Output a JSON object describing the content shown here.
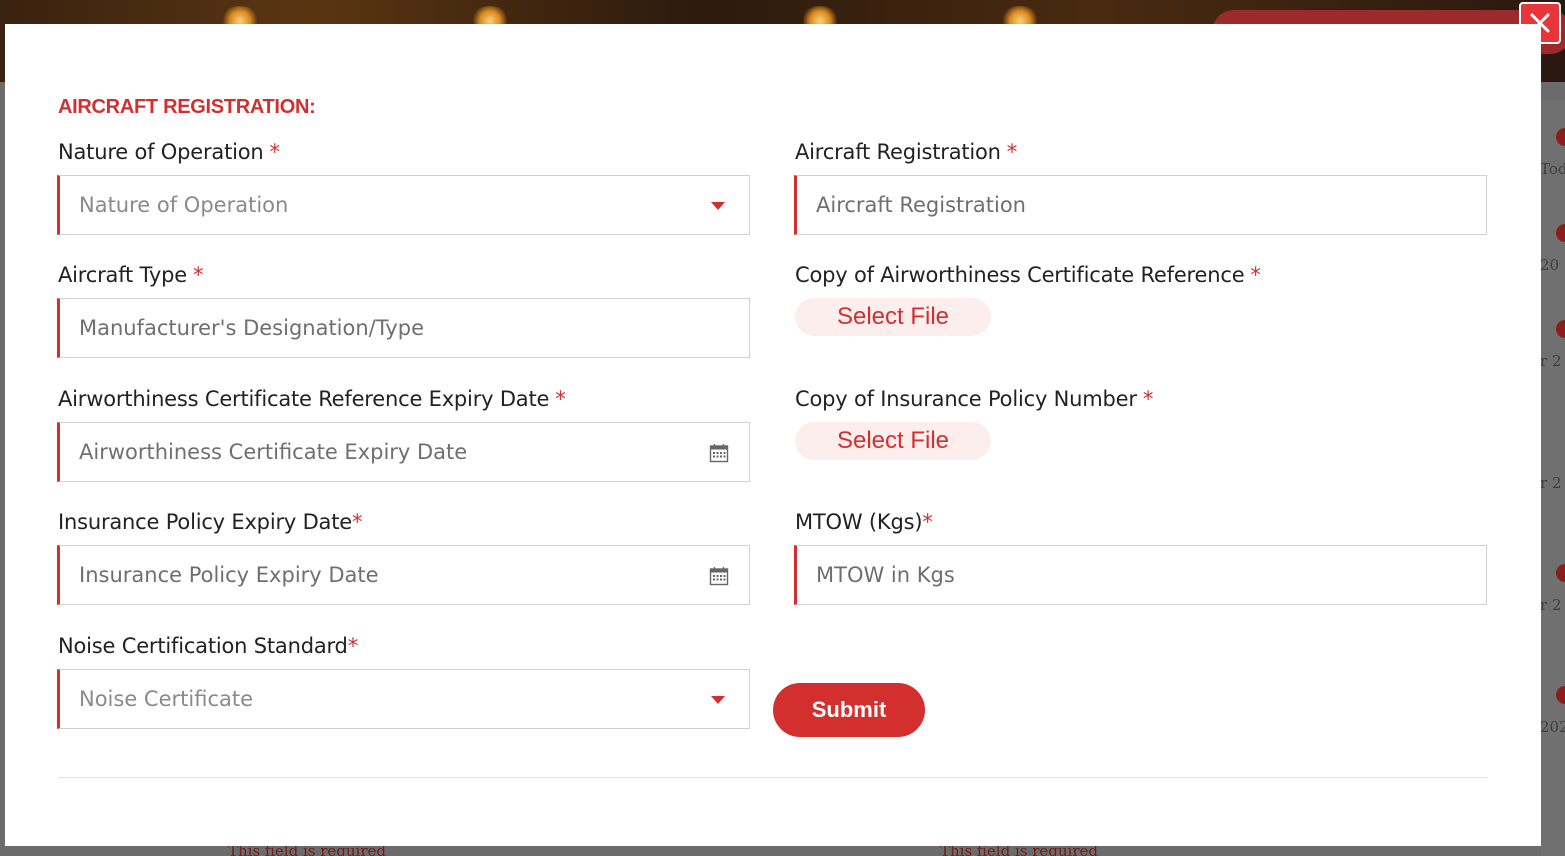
{
  "section_title": "AIRCRAFT REGISTRATION:",
  "required_mark": "*",
  "close_label": "close",
  "fields": {
    "nature_of_operation": {
      "label": "Nature of Operation",
      "placeholder": "Nature of Operation",
      "type": "select"
    },
    "aircraft_registration": {
      "label": "Aircraft Registration",
      "placeholder": "Aircraft Registration",
      "type": "text"
    },
    "aircraft_type": {
      "label": "Aircraft Type",
      "placeholder": "Manufacturer's Designation/Type",
      "type": "text"
    },
    "airworthiness_copy": {
      "label": "Copy of Airworthiness Certificate Reference",
      "button": "Select File",
      "type": "file"
    },
    "airworthiness_expiry": {
      "label": "Airworthiness Certificate Reference Expiry Date",
      "placeholder": "Airworthiness Certificate Expiry Date",
      "type": "date"
    },
    "insurance_copy": {
      "label": "Copy of Insurance Policy Number",
      "button": "Select File",
      "type": "file"
    },
    "insurance_expiry": {
      "label": "Insurance Policy Expiry Date",
      "placeholder": "Insurance Policy Expiry Date",
      "type": "date"
    },
    "mtow": {
      "label": "MTOW (Kgs)",
      "placeholder": "MTOW in Kgs",
      "type": "text"
    },
    "noise_cert": {
      "label": "Noise Certification Standard",
      "placeholder": "Noise Certificate",
      "type": "select"
    }
  },
  "submit_label": "Submit",
  "background": {
    "error_text_1": "This field is required",
    "error_text_2": "This field is required",
    "side_texts": [
      "Tod",
      "20",
      "r 2",
      "r 2",
      "r 2",
      "202"
    ]
  },
  "colors": {
    "accent": "#d32f2f",
    "close": "#e8353a",
    "file_button_bg": "#fdeeee"
  },
  "icons": {
    "close": "close-icon",
    "dropdown": "chevron-down-icon",
    "date": "calendar-icon"
  }
}
